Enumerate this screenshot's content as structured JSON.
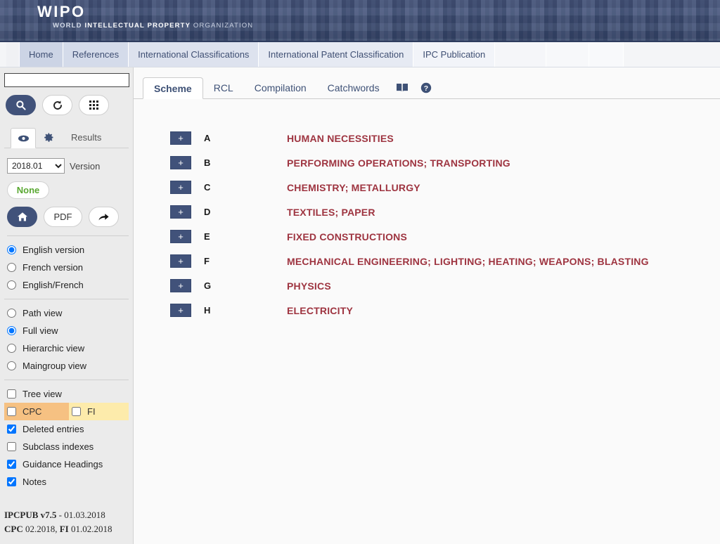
{
  "header": {
    "logo_main": "WIPO",
    "logo_sub_world": "WORLD",
    "logo_sub_ip": "INTELLECTUAL PROPERTY",
    "logo_sub_org": "ORGANIZATION"
  },
  "topnav": {
    "items": [
      {
        "label": "Home"
      },
      {
        "label": "References"
      },
      {
        "label": "International Classifications"
      },
      {
        "label": "International Patent Classification"
      },
      {
        "label": "IPC Publication"
      }
    ]
  },
  "sidebar": {
    "search": {
      "value": "",
      "placeholder": ""
    },
    "buttons": [
      {
        "name": "search-button",
        "icon": "magnifier-icon",
        "label": ""
      },
      {
        "name": "refresh-button",
        "icon": "refresh-icon",
        "label": ""
      },
      {
        "name": "grid-button",
        "icon": "grid-icon",
        "label": ""
      }
    ],
    "mini_tabs": [
      {
        "name": "view-tab",
        "icon": "eye-icon"
      },
      {
        "name": "settings-tab",
        "icon": "gear-icon"
      }
    ],
    "results_label": "Results",
    "version": {
      "selected": "2018.01",
      "label": "Version",
      "options": [
        "2018.01"
      ]
    },
    "none_button": "None",
    "actions": [
      {
        "name": "home-button",
        "icon": "home-icon",
        "label": ""
      },
      {
        "name": "pdf-button",
        "icon": "",
        "label": "PDF"
      },
      {
        "name": "share-button",
        "icon": "share-arrow-icon",
        "label": ""
      }
    ],
    "language_options": [
      {
        "label": "English version",
        "checked": true
      },
      {
        "label": "French version",
        "checked": false
      },
      {
        "label": "English/French",
        "checked": false
      }
    ],
    "view_options": [
      {
        "label": "Path view",
        "checked": false
      },
      {
        "label": "Full view",
        "checked": true
      },
      {
        "label": "Hierarchic view",
        "checked": false
      },
      {
        "label": "Maingroup view",
        "checked": false
      }
    ],
    "toggles": [
      {
        "label": "Tree view",
        "checked": false
      },
      {
        "label": "CPC",
        "checked": false,
        "highlight": "#f6c182"
      },
      {
        "label": "FI",
        "checked": false,
        "highlight": "#fdebab"
      },
      {
        "label": "Deleted entries",
        "checked": true
      },
      {
        "label": "Subclass indexes",
        "checked": false
      },
      {
        "label": "Guidance Headings",
        "checked": true
      },
      {
        "label": "Notes",
        "checked": true
      }
    ],
    "footer": {
      "line1_bold": "IPCPUB v7.5",
      "line1_rest": " - 01.03.2018",
      "line2_bold1": "CPC",
      "line2_mid": " 02.2018, ",
      "line2_bold2": "FI",
      "line2_rest": " 01.02.2018"
    }
  },
  "main": {
    "tabs": [
      {
        "label": "Scheme",
        "active": true
      },
      {
        "label": "RCL",
        "active": false
      },
      {
        "label": "Compilation",
        "active": false
      },
      {
        "label": "Catchwords",
        "active": false
      }
    ],
    "tab_icons": [
      {
        "name": "book-icon"
      },
      {
        "name": "help-icon"
      }
    ],
    "sections": [
      {
        "expand": "+",
        "letter": "A",
        "title": "HUMAN NECESSITIES"
      },
      {
        "expand": "+",
        "letter": "B",
        "title": "PERFORMING OPERATIONS; TRANSPORTING"
      },
      {
        "expand": "+",
        "letter": "C",
        "title": "CHEMISTRY; METALLURGY"
      },
      {
        "expand": "+",
        "letter": "D",
        "title": "TEXTILES; PAPER"
      },
      {
        "expand": "+",
        "letter": "E",
        "title": "FIXED CONSTRUCTIONS"
      },
      {
        "expand": "+",
        "letter": "F",
        "title": "MECHANICAL ENGINEERING; LIGHTING; HEATING; WEAPONS; BLASTING"
      },
      {
        "expand": "+",
        "letter": "G",
        "title": "PHYSICS"
      },
      {
        "expand": "+",
        "letter": "H",
        "title": "ELECTRICITY"
      }
    ]
  },
  "colors": {
    "brand_blue": "#41527a",
    "section_title": "#9e3440",
    "accent_green": "#5aa832",
    "cpc_highlight": "#f6c182",
    "fi_highlight": "#fdebab"
  }
}
